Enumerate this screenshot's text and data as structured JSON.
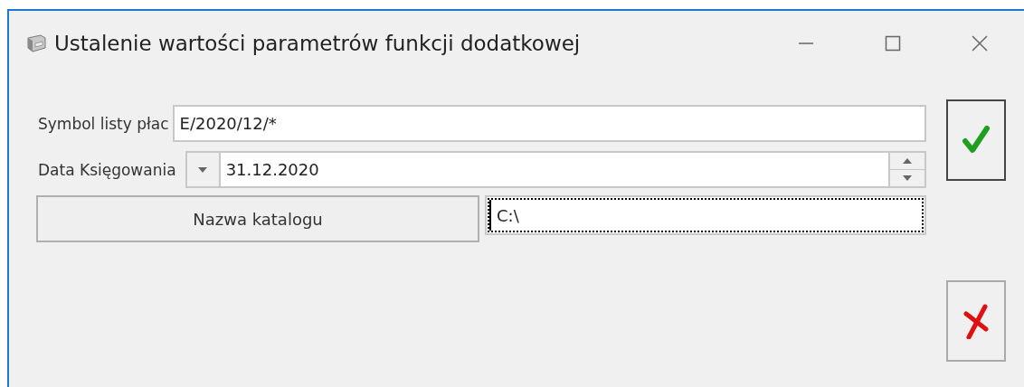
{
  "window": {
    "title": "Ustalenie wartości parametrów funkcji dodatkowej"
  },
  "fields": [
    {
      "kind": "text",
      "label": "Symbol listy płac",
      "value": "E/2020/12/*"
    },
    {
      "kind": "date",
      "label": "Data Księgowania",
      "value": "31.12.2020"
    },
    {
      "kind": "browse",
      "label": "Nazwa katalogu",
      "value": "C:\\",
      "focused": true
    }
  ]
}
